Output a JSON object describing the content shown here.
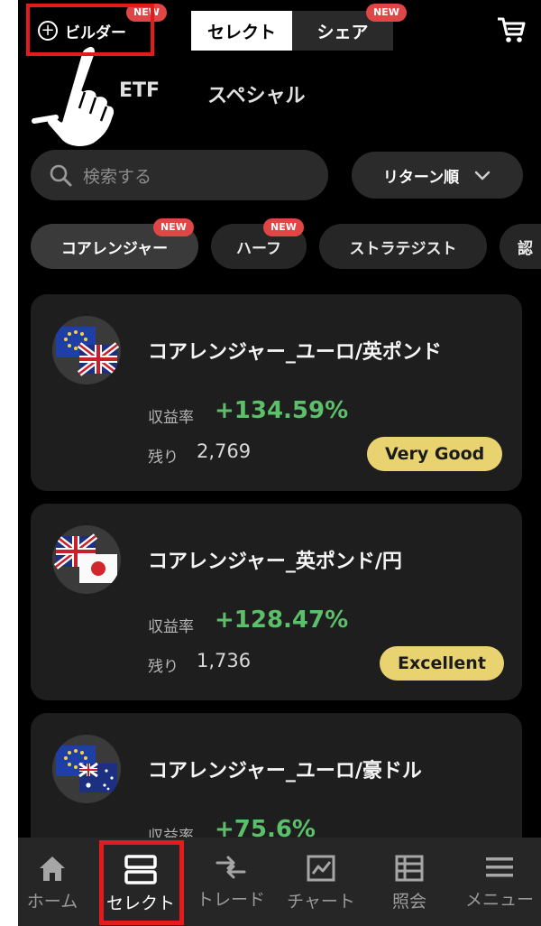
{
  "header": {
    "builder_label": "ビルダー",
    "builder_badge": "NEW",
    "segments": [
      "セレクト",
      "シェア"
    ],
    "share_badge": "NEW",
    "cart_icon": "cart-icon"
  },
  "subtabs": [
    "ETF",
    "スペシャル"
  ],
  "search": {
    "placeholder": "検索する"
  },
  "sort": {
    "label": "リターン順"
  },
  "chips": [
    {
      "label": "コアレンジャー",
      "badge": "NEW"
    },
    {
      "label": "ハーフ",
      "badge": "NEW"
    },
    {
      "label": "ストラテジスト"
    },
    {
      "label": "認"
    }
  ],
  "strategies": [
    {
      "name": "コアレンジャー_ユーロ/英ポンド",
      "return_label": "収益率",
      "return_value": "+134.59%",
      "remaining_label": "残り",
      "remaining_value": "2,769",
      "rating": "Very Good"
    },
    {
      "name": "コアレンジャー_英ポンド/円",
      "return_label": "収益率",
      "return_value": "+128.47%",
      "remaining_label": "残り",
      "remaining_value": "1,736",
      "rating": "Excellent"
    },
    {
      "name": "コアレンジャー_ユーロ/豪ドル",
      "return_label": "収益率",
      "return_value": "+75.6%"
    }
  ],
  "bottom_nav": [
    {
      "label": "ホーム",
      "icon": "home-icon"
    },
    {
      "label": "セレクト",
      "icon": "select-icon",
      "active": true
    },
    {
      "label": "トレード",
      "icon": "trade-icon"
    },
    {
      "label": "チャート",
      "icon": "chart-icon"
    },
    {
      "label": "照会",
      "icon": "inquiry-icon"
    },
    {
      "label": "メニュー",
      "icon": "menu-icon"
    }
  ],
  "colors": {
    "background": "#000000",
    "positive": "#5cbf6a",
    "rating_badge": "#e9d370",
    "new_badge": "#e04646",
    "annotation": "#e41b1b"
  }
}
